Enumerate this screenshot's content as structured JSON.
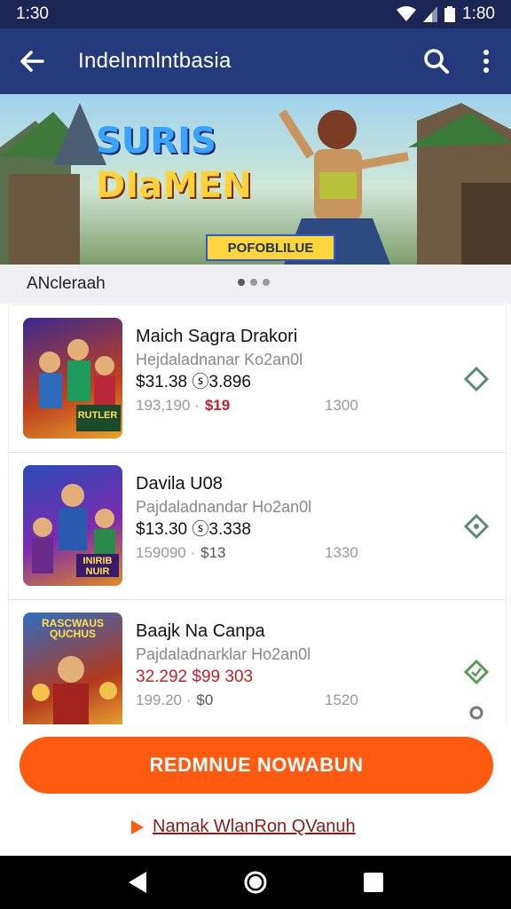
{
  "status": {
    "time_left": "1:30",
    "time_right": "1:80"
  },
  "app_bar": {
    "title": "Indelnmlntbasia"
  },
  "banner": {
    "logo_line1": "SURIS",
    "logo_line2": "DIaMEN",
    "tag": "POFOBLILUE"
  },
  "section": {
    "title": "ANcleraah"
  },
  "items": [
    {
      "title": "Maich Sagra Drakori",
      "subtitle": "Hejdaladnanar Ko2an0l",
      "price": "$31.38 ⓢ3.896",
      "meta_a": "193,190 ·",
      "meta_price": "$19",
      "meta_count": "1300",
      "thumb_text": "RUTLER"
    },
    {
      "title": "Davila U08",
      "subtitle": "Pajdaladnandar Ho2an0l",
      "price": "$13.30 ⓢ3.338",
      "meta_a": "159090 ·",
      "meta_price": "$13",
      "meta_count": "1330",
      "thumb_text": "INIRIB NUIR"
    },
    {
      "title": "Baajk Na Canpa",
      "subtitle": "Pajdaladnarklar Ho2an0l",
      "price": "32.292 $99 303",
      "meta_a": "199.20 ·",
      "meta_price": "$0",
      "meta_count": "1520",
      "thumb_text": "RASCWAUS QUCHUS"
    }
  ],
  "cta": {
    "label": "REDMNUE NOWABUN"
  },
  "link": {
    "label": "Namak WlanRon QVanuh"
  },
  "colors": {
    "header": "#243a7a",
    "status": "#1b2654",
    "accent": "#ff5a10",
    "price_red": "#c4202a"
  }
}
